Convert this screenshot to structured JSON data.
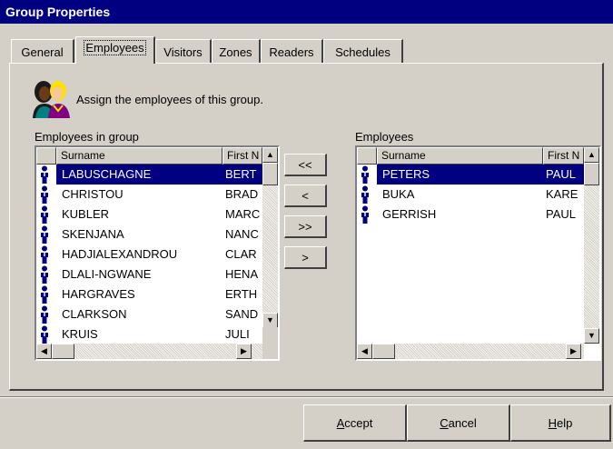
{
  "window": {
    "title": "Group Properties"
  },
  "tabs": [
    {
      "label": "General"
    },
    {
      "label": "Employees"
    },
    {
      "label": "Visitors"
    },
    {
      "label": "Zones"
    },
    {
      "label": "Readers"
    },
    {
      "label": "Schedules"
    }
  ],
  "instruction": "Assign the employees of this group.",
  "group_list": {
    "label": "Employees in group",
    "columns": {
      "surname": "Surname",
      "first": "First N"
    },
    "rows": [
      {
        "surname": "LABUSCHAGNE",
        "first": "BERT",
        "selected": true
      },
      {
        "surname": "CHRISTOU",
        "first": "BRAD"
      },
      {
        "surname": "KUBLER",
        "first": "MARC"
      },
      {
        "surname": "SKENJANA",
        "first": "NANC"
      },
      {
        "surname": "HADJIALEXANDROU",
        "first": "CLAR"
      },
      {
        "surname": "DLALI-NGWANE",
        "first": "HENA"
      },
      {
        "surname": "HARGRAVES",
        "first": "ERTH"
      },
      {
        "surname": "CLARKSON",
        "first": "SAND"
      },
      {
        "surname": "KRUIS",
        "first": "JULI"
      }
    ]
  },
  "employee_list": {
    "label": "Employees",
    "columns": {
      "surname": "Surname",
      "first": "First N"
    },
    "rows": [
      {
        "surname": "PETERS",
        "first": "PAUL",
        "selected": true
      },
      {
        "surname": "BUKA",
        "first": "KARE"
      },
      {
        "surname": "GERRISH",
        "first": "PAUL"
      }
    ]
  },
  "transfer": {
    "add_all": "<<",
    "add_one": "<",
    "remove_all": ">>",
    "remove_one": ">"
  },
  "footer": {
    "accept": {
      "pre": "",
      "key": "A",
      "post": "ccept"
    },
    "cancel": {
      "pre": "",
      "key": "C",
      "post": "ancel"
    },
    "help": {
      "pre": "",
      "key": "H",
      "post": "elp"
    }
  },
  "icons": {
    "people": "group-people-icon",
    "person": "employee-person-icon"
  },
  "colors": {
    "title_bar": "#000080",
    "selection": "#000080",
    "dialog_face": "#d4d0c8"
  }
}
